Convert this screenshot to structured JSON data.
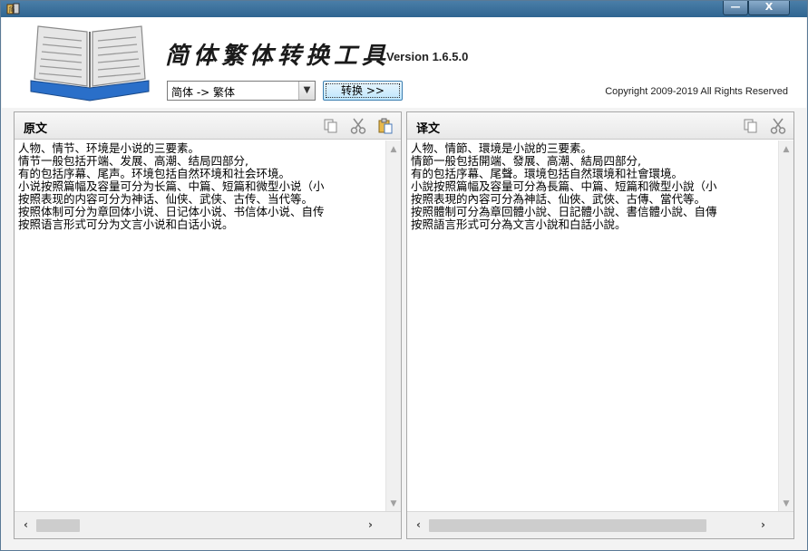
{
  "window": {
    "minimize_glyph": "—",
    "close_glyph": "X"
  },
  "header": {
    "app_title": "简体繁体转换工具",
    "version": "Version 1.6.5.0",
    "copyright": "Copyright 2009-2019 All Rights Reserved",
    "mode_select_value": "简体 -> 繁体",
    "convert_button_label": "转换 >>"
  },
  "left_panel": {
    "title": "原文",
    "icons": [
      "copy-icon",
      "cut-icon",
      "paste-icon"
    ],
    "lines": [
      "人物、情节、环境是小说的三要素。",
      "情节一般包括开端、发展、高潮、结局四部分,",
      "有的包括序幕、尾声。环境包括自然环境和社会环境。",
      "小说按照篇幅及容量可分为长篇、中篇、短篇和微型小说（小",
      "按照表现的内容可分为神话、仙侠、武侠、古传、当代等。",
      "按照体制可分为章回体小说、日记体小说、书信体小说、自传",
      "按照语言形式可分为文言小说和白话小说。"
    ]
  },
  "right_panel": {
    "title": "译文",
    "icons": [
      "copy-icon",
      "cut-icon"
    ],
    "lines": [
      "人物、情節、環境是小說的三要素。",
      "情節一般包括開端、發展、高潮、結局四部分,",
      "有的包括序幕、尾聲。環境包括自然環境和社會環境。",
      "小說按照篇幅及容量可分為長篇、中篇、短篇和微型小說（小",
      "按照表現的內容可分為神話、仙俠、武俠、古傳、當代等。",
      "按照體制可分為章回體小說、日記體小說、書信體小說、自傳",
      "按照語言形式可分為文言小說和白話小說。"
    ]
  },
  "colors": {
    "titlebar": "#3a71a0",
    "book_cover": "#2a6fc9",
    "button_border": "#3c7fb1"
  }
}
